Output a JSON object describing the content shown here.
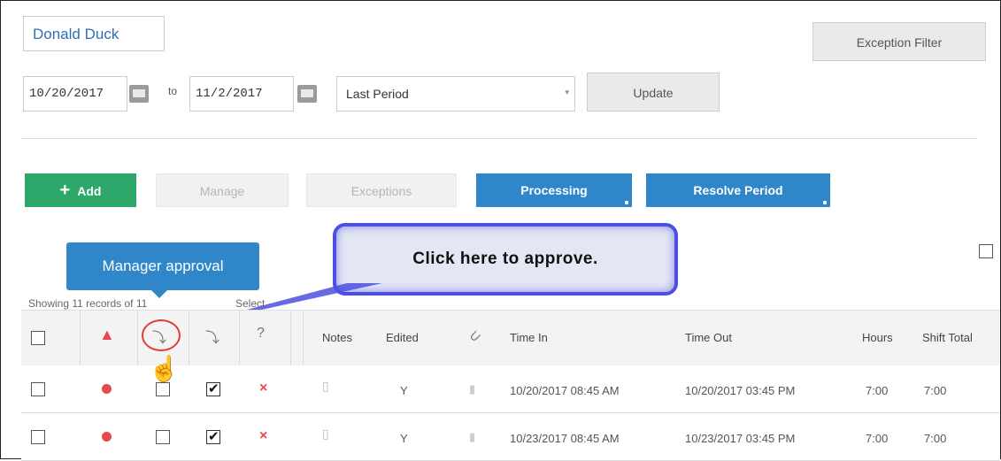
{
  "header": {
    "employee_name": "Donald Duck",
    "exception_filter_label": "Exception Filter"
  },
  "date_range": {
    "from": "10/20/2017",
    "to_label": "to",
    "to": "11/2/2017",
    "period": "Last Period",
    "update_label": "Update"
  },
  "actions": {
    "add_label": "Add",
    "manage_label": "Manage",
    "exceptions_label": "Exceptions",
    "processing_label": "Processing",
    "resolve_label": "Resolve Period"
  },
  "tooltip": {
    "text": "Manager approval"
  },
  "callout": {
    "text": "Click here to approve."
  },
  "records_info": "Showing 11 records of 11",
  "select_label": "Select",
  "table": {
    "headers": {
      "notes": "Notes",
      "edited": "Edited",
      "time_in": "Time In",
      "time_out": "Time Out",
      "hours": "Hours",
      "shift_total": "Shift Total"
    },
    "rows": [
      {
        "edited": "Y",
        "time_in": "10/20/2017 08:45 AM",
        "time_out": "10/20/2017 03:45 PM",
        "hours": "7:00",
        "shift_total": "7:00"
      },
      {
        "edited": "Y",
        "time_in": "10/23/2017 08:45 AM",
        "time_out": "10/23/2017 03:45 PM",
        "hours": "7:00",
        "shift_total": "7:00"
      }
    ]
  },
  "icons": {
    "alert": "bell-icon",
    "manager_approval": "approve-check-icon",
    "employee_approval": "approve-down-icon",
    "pending": "approve-question-icon",
    "attachment": "paperclip-icon"
  },
  "colors": {
    "accent_blue": "#2f86c9",
    "add_green": "#2ea86a",
    "alert_red": "#e5484d",
    "callout_border": "#4c4fe0"
  }
}
